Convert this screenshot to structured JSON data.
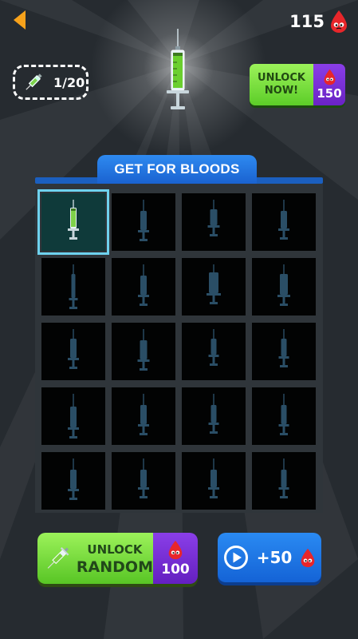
{
  "header": {
    "blood_count": "115",
    "blood_icon": "blood-drop-icon",
    "back_icon": "back-arrow-icon"
  },
  "collection": {
    "progress": "1/20"
  },
  "unlock_now": {
    "line1": "UNLOCK",
    "line2": "NOW!",
    "price": "150"
  },
  "tab": {
    "label": "GET FOR BLOODS"
  },
  "grid": {
    "rows": 5,
    "cols": 4,
    "selected_index": 0
  },
  "unlock_random": {
    "line1": "UNLOCK",
    "line2": "RANDOM",
    "price": "100"
  },
  "watch_ad": {
    "reward": "+50",
    "icon": "play-icon"
  },
  "colors": {
    "background": "#262b30",
    "accent_blue": "#1a62d0",
    "green": "#5ccd28",
    "purple": "#6a23c4",
    "silhouette": "#2a4e66",
    "selection": "#6ed2ee"
  }
}
